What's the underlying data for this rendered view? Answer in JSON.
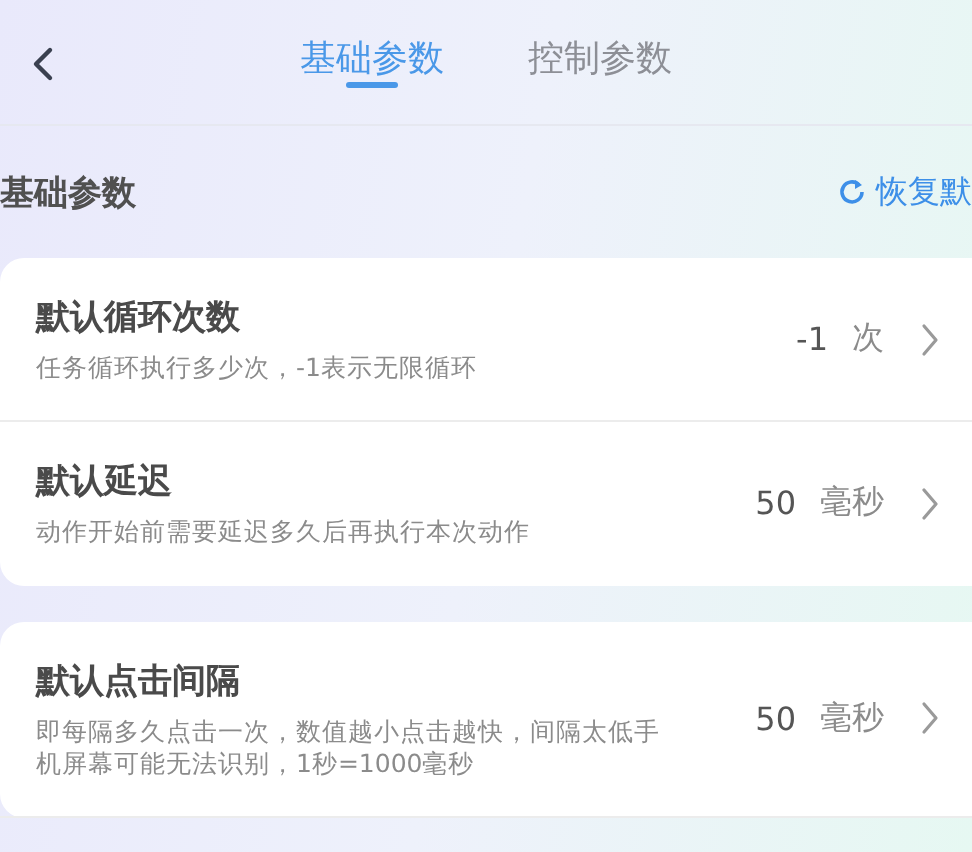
{
  "tabs": [
    {
      "label": "基础参数",
      "selected": true
    },
    {
      "label": "控制参数",
      "selected": false
    }
  ],
  "section": {
    "title": "基础参数",
    "reset_link": "恢复默"
  },
  "cards": [
    {
      "rows": [
        {
          "title": "默认循环次数",
          "description": "任务循环执行多少次，-1表示无限循环",
          "value": "-1",
          "unit": "次"
        },
        {
          "title": "默认延迟",
          "description": "动作开始前需要延迟多久后再执行本次动作",
          "value": "50",
          "unit": "毫秒"
        }
      ]
    },
    {
      "rows": [
        {
          "title": "默认点击间隔",
          "description": "即每隔多久点击一次，数值越小点击越快，间隔太低手机屏幕可能无法识别，1秒=1000毫秒",
          "value": "50",
          "unit": "毫秒"
        }
      ]
    }
  ]
}
